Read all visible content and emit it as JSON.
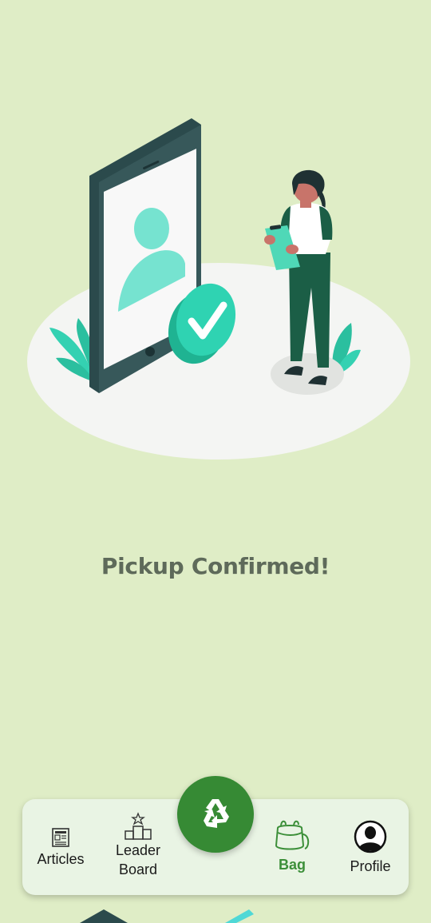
{
  "confirmation": {
    "title": "Pickup Confirmed!"
  },
  "nav": {
    "items": [
      {
        "label": "Articles",
        "icon": "newspaper-icon"
      },
      {
        "label_line1": "Leader",
        "label_line2": "Board",
        "icon": "podium-icon"
      },
      {
        "label": "Bag",
        "icon": "bag-icon",
        "active": true
      },
      {
        "label": "Profile",
        "icon": "profile-icon"
      }
    ],
    "fab_icon": "recycle-icon"
  },
  "colors": {
    "background": "#dfedc6",
    "accent_green": "#368a34",
    "active_label": "#3c8f39",
    "nav_background": "#e9f4e4",
    "title_text": "#5e6a5a"
  }
}
